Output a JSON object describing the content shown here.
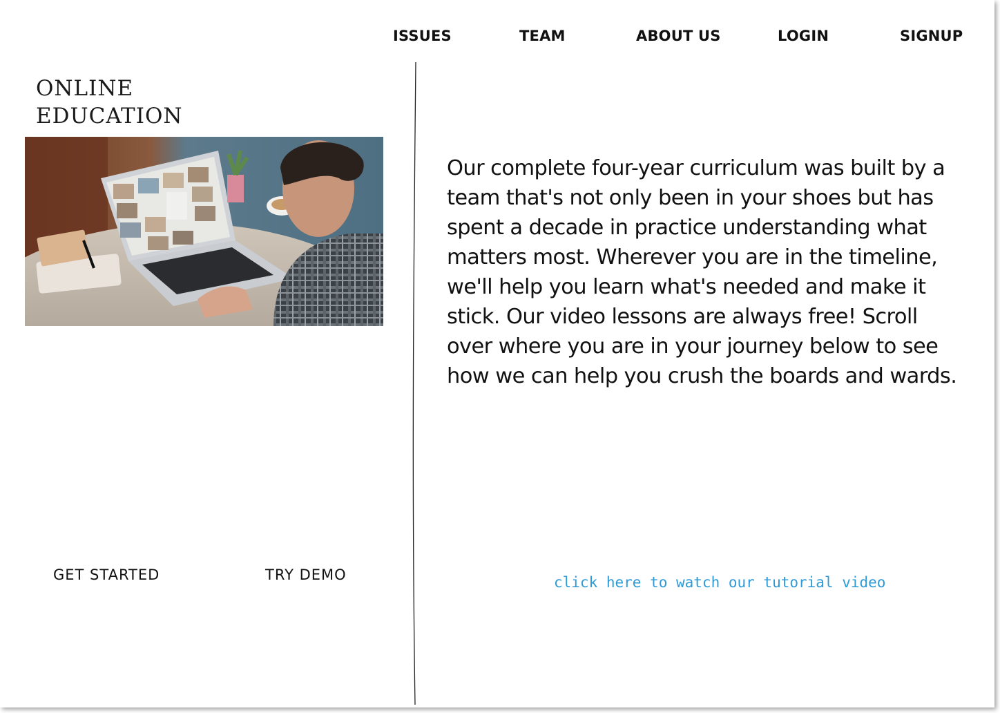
{
  "nav": {
    "items": [
      {
        "label": "ISSUES"
      },
      {
        "label": "TEAM"
      },
      {
        "label": "ABOUT US"
      },
      {
        "label": "LOGIN"
      },
      {
        "label": "SIGNUP"
      }
    ]
  },
  "brand": {
    "line1": "ONLINE",
    "line2": "EDUCATION"
  },
  "hero_image": {
    "icon": "online-class-laptop-image"
  },
  "actions": {
    "get_started_label": "GET STARTED",
    "try_demo_label": "TRY DEMO"
  },
  "main": {
    "description": "Our complete four-year curriculum was built by a team that's not only been in your shoes but has spent a decade in practice understanding what matters most. Wherever you are in the timeline, we'll help you learn what's needed and make it stick. Our video lessons are always free! Scroll over where you are in your journey below to see how we can help you crush the boards and wards.",
    "tutorial_link": "click here to watch our tutorial video"
  },
  "colors": {
    "link": "#2e9ad6",
    "text": "#111111",
    "background": "#ffffff"
  }
}
